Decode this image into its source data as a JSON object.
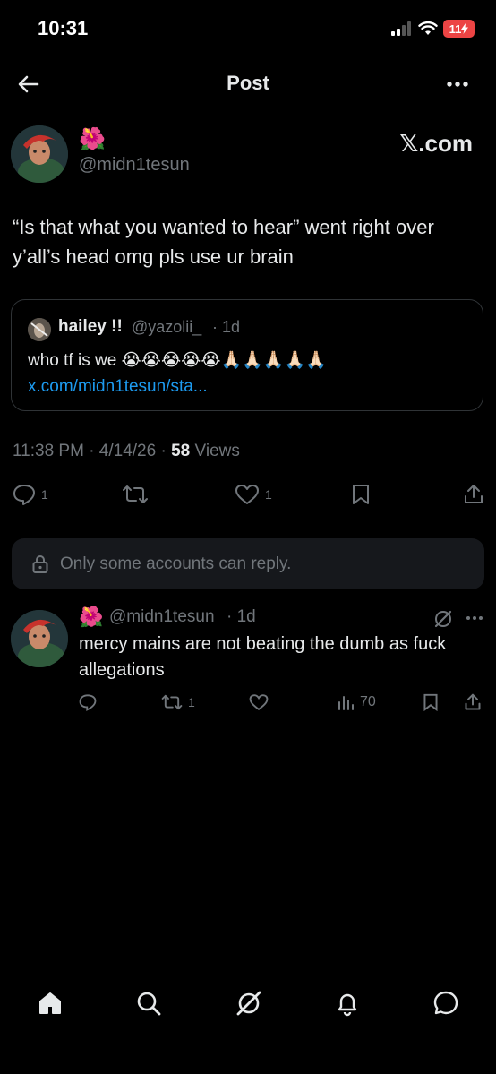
{
  "status_bar": {
    "time": "10:31",
    "battery": "11"
  },
  "nav": {
    "title": "Post"
  },
  "post": {
    "author_emoji": "🌺",
    "handle": "@midn1tesun",
    "source_label": "𝕏.com",
    "text": "“Is that what you wanted to hear” went right over y’all’s head omg pls use ur brain",
    "quote": {
      "author_name": "hailey !!",
      "author_handle": "@yazolii_",
      "time": "· 1d",
      "text": "who tf is we 😭😭😭😭😭🙏🏻🙏🏻🙏🏻🙏🏻🙏🏻",
      "link": "x.com/midn1tesun/sta..."
    },
    "timestamp": "11:38 PM · 4/14/26 ·",
    "views_count": "58",
    "views_label": "Views",
    "actions": {
      "replies": "1",
      "reposts": "",
      "likes": "1"
    }
  },
  "reply_restriction": "Only some accounts can reply.",
  "reply": {
    "author_emoji": "🌺",
    "handle": "@midn1tesun",
    "time": "· 1d",
    "text": "mercy mains are not beating the dumb as fuck allegations",
    "reposts": "1",
    "views": "70"
  },
  "tabbar": {
    "items": [
      "home",
      "search",
      "grok",
      "notifications",
      "messages"
    ]
  },
  "colors": {
    "background": "#000000",
    "text": "#e7e9ea",
    "muted": "#71767b",
    "link": "#1d9bf0",
    "border": "#2f3336",
    "battery": "#ec4444"
  }
}
